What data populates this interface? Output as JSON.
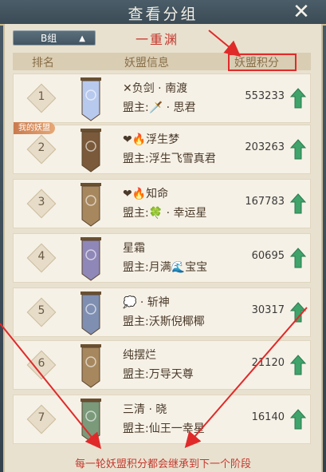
{
  "header": {
    "title": "查看分组",
    "close_icon": "close-icon"
  },
  "group_select": {
    "value": "B组"
  },
  "division_label": "一重渊",
  "columns": {
    "rank": "排名",
    "info": "妖盟信息",
    "score": "妖盟积分"
  },
  "my_alliance_tag": "我的妖盟",
  "leader_prefix": "盟主:",
  "rows": [
    {
      "rank": "1",
      "name": "✕负剑 · 南渡",
      "leader": "盟主:🗡️ · 思君",
      "score": "553233",
      "banner_color": "#b8c9ee",
      "trend": "up"
    },
    {
      "rank": "2",
      "name": "❤🔥浮生梦",
      "leader": "盟主:浮生飞雪真君",
      "score": "203263",
      "banner_color": "#7a5a3a",
      "trend": "up",
      "mine": true
    },
    {
      "rank": "3",
      "name": "❤🔥知命",
      "leader": "盟主:🍀 · 幸运星",
      "score": "167783",
      "banner_color": "#a7885e",
      "trend": "up"
    },
    {
      "rank": "4",
      "name": "星霜",
      "leader": "盟主:月满🌊宝宝",
      "score": "60695",
      "banner_color": "#8f87b7",
      "trend": "up"
    },
    {
      "rank": "5",
      "name": "💭 · 斩神",
      "leader": "盟主:沃斯倪椰椰",
      "score": "30317",
      "banner_color": "#7f8fb2",
      "trend": "up"
    },
    {
      "rank": "6",
      "name": "纯摆烂",
      "leader": "盟主:万导天尊",
      "score": "21120",
      "banner_color": "#a7885e",
      "trend": "up"
    },
    {
      "rank": "7",
      "name": "三清 · 晓",
      "leader": "盟主:仙王一幸星",
      "score": "16140",
      "banner_color": "#7a9a7a",
      "trend": "up"
    }
  ],
  "footer_note": "每一轮妖盟积分都会继承到下一个阶段",
  "colors": {
    "accent_red": "#c4382e",
    "highlight_red": "#e02a2a",
    "trend_green": "#3fa36a"
  }
}
